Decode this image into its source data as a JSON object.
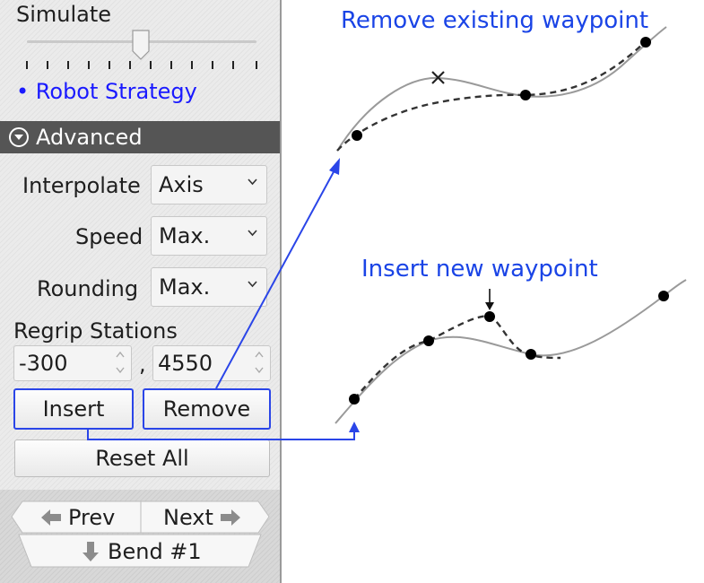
{
  "panel": {
    "simulate_label": "Simulate",
    "slider_value": 0.5,
    "strategy_link": "• Robot Strategy",
    "advanced_label": "Advanced",
    "interpolate": {
      "label": "Interpolate",
      "value": "Axis"
    },
    "speed": {
      "label": "Speed",
      "value": "Max."
    },
    "rounding": {
      "label": "Rounding",
      "value": "Max."
    },
    "regrip": {
      "label": "Regrip Stations",
      "value1": "-300",
      "separator": ",",
      "value2": "4550"
    },
    "insert_label": "Insert",
    "remove_label": "Remove",
    "reset_label": "Reset All",
    "prev_label": "Prev",
    "next_label": "Next",
    "bend_label": "Bend #1"
  },
  "annotations": {
    "remove_caption": "Remove existing waypoint",
    "insert_caption": "Insert new waypoint",
    "accent_color": "#1a44e6"
  }
}
